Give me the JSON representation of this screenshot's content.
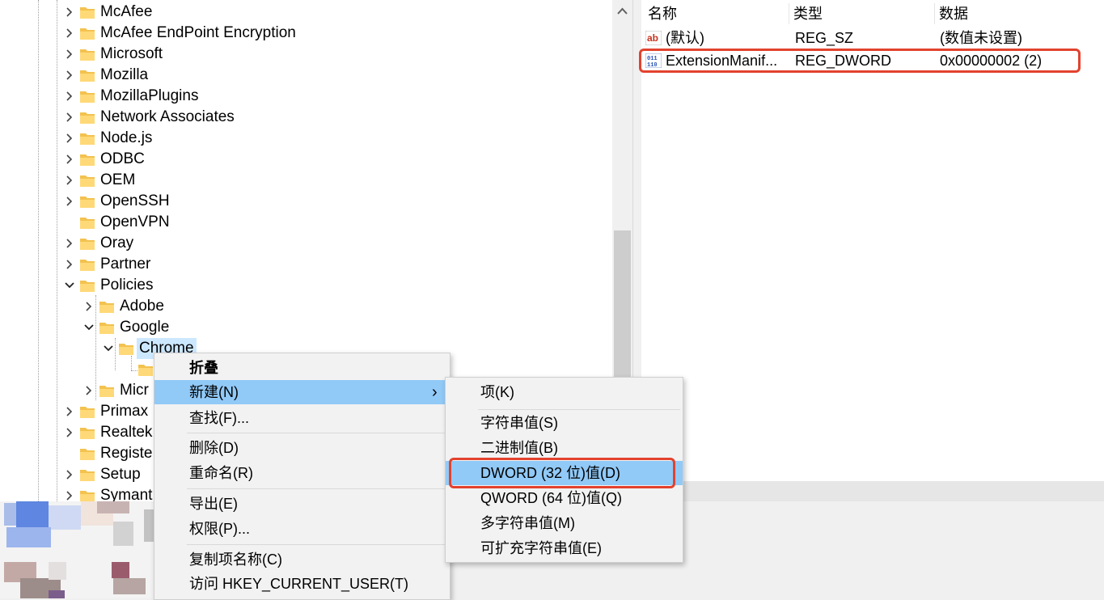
{
  "tree": {
    "items": [
      {
        "label": "McAfee",
        "expand": "collapsed"
      },
      {
        "label": "McAfee EndPoint Encryption",
        "expand": "collapsed"
      },
      {
        "label": "Microsoft",
        "expand": "collapsed"
      },
      {
        "label": "Mozilla",
        "expand": "collapsed"
      },
      {
        "label": "MozillaPlugins",
        "expand": "collapsed"
      },
      {
        "label": "Network Associates",
        "expand": "collapsed"
      },
      {
        "label": "Node.js",
        "expand": "collapsed"
      },
      {
        "label": "ODBC",
        "expand": "collapsed"
      },
      {
        "label": "OEM",
        "expand": "collapsed"
      },
      {
        "label": "OpenSSH",
        "expand": "collapsed"
      },
      {
        "label": "OpenVPN",
        "expand": "none"
      },
      {
        "label": "Oray",
        "expand": "collapsed"
      },
      {
        "label": "Partner",
        "expand": "collapsed"
      },
      {
        "label": "Policies",
        "expand": "expanded"
      },
      {
        "label": "Adobe",
        "expand": "collapsed"
      },
      {
        "label": "Google",
        "expand": "expanded"
      },
      {
        "label": "Chrome",
        "expand": "expanded",
        "selected": true
      },
      {
        "label": "",
        "expand": "none"
      },
      {
        "label": "Micr",
        "expand": "collapsed"
      },
      {
        "label": "Primax",
        "expand": "collapsed"
      },
      {
        "label": "Realtek",
        "expand": "collapsed"
      },
      {
        "label": "Registe",
        "expand": "none"
      },
      {
        "label": "Setup",
        "expand": "collapsed"
      },
      {
        "label": "Symant",
        "expand": "collapsed"
      }
    ]
  },
  "values_pane": {
    "headers": {
      "name": "名称",
      "type": "类型",
      "data": "数据"
    },
    "rows": [
      {
        "icon": "string-value-icon",
        "name": "(默认)",
        "type": "REG_SZ",
        "data": "(数值未设置)"
      },
      {
        "icon": "binary-value-icon",
        "name": "ExtensionManif...",
        "type": "REG_DWORD",
        "data": "0x00000002 (2)"
      }
    ]
  },
  "context_menu": {
    "items": [
      {
        "label": "折叠",
        "bold": true
      },
      {
        "label": "新建(N)",
        "submenu": true,
        "highlighted": true
      },
      {
        "label": "查找(F)..."
      },
      {
        "label": "删除(D)"
      },
      {
        "label": "重命名(R)"
      },
      {
        "label": "导出(E)"
      },
      {
        "label": "权限(P)..."
      },
      {
        "label": "复制项名称(C)"
      },
      {
        "label": "访问 HKEY_CURRENT_USER(T)"
      }
    ],
    "arrow": "›"
  },
  "submenu": {
    "items": [
      {
        "label": "项(K)"
      },
      {
        "label": "字符串值(S)"
      },
      {
        "label": "二进制值(B)"
      },
      {
        "label": "DWORD (32 位)值(D)",
        "highlighted": true
      },
      {
        "label": "QWORD (64 位)值(Q)"
      },
      {
        "label": "多字符串值(M)"
      },
      {
        "label": "可扩充字符串值(E)"
      }
    ]
  },
  "colors": {
    "highlight": "#91c9f7",
    "selection": "#cce8ff",
    "annotation": "#e2422e",
    "folder": "#f3c24f"
  }
}
